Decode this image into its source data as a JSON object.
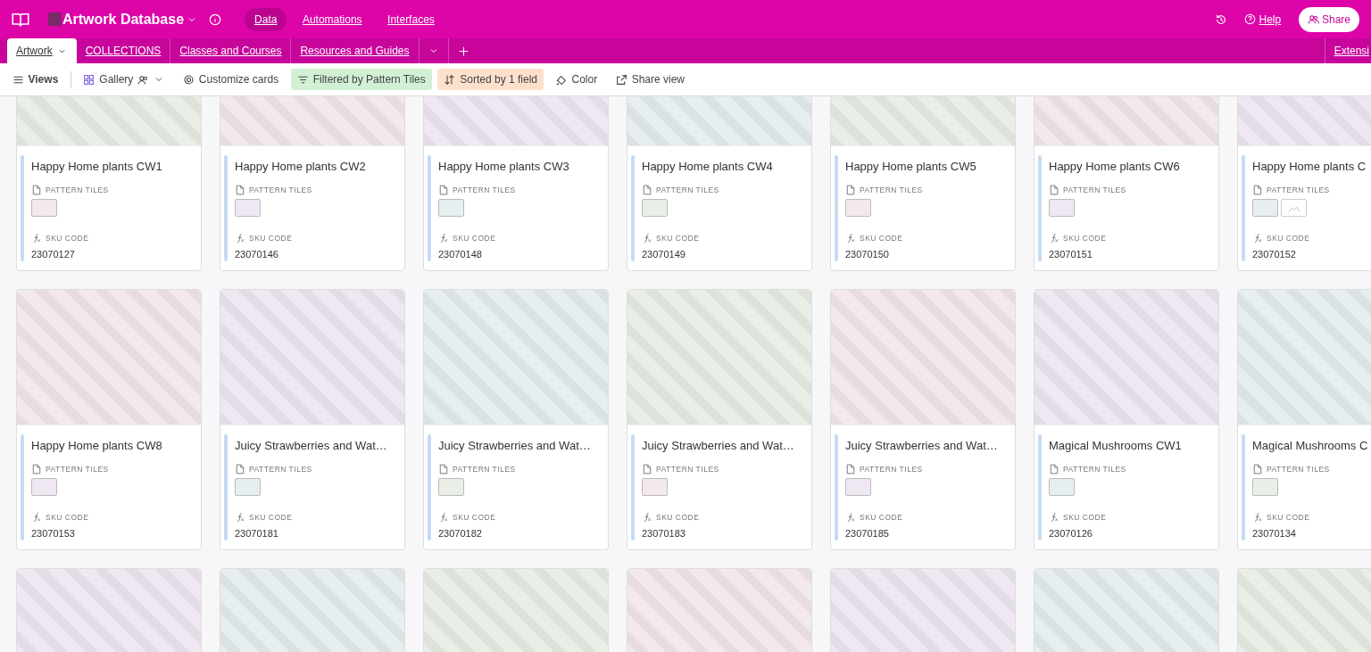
{
  "app": {
    "title": "Artwork Database",
    "nav": [
      {
        "label": "Data",
        "selected": true
      },
      {
        "label": "Automations",
        "selected": false
      },
      {
        "label": "Interfaces",
        "selected": false
      }
    ],
    "help": "Help",
    "share": "Share"
  },
  "tables": [
    {
      "label": "Artwork",
      "selected": true
    },
    {
      "label": "COLLECTIONS",
      "selected": false
    },
    {
      "label": "Classes and Courses",
      "selected": false
    },
    {
      "label": "Resources and Guides",
      "selected": false
    }
  ],
  "extensions": "Extensi",
  "toolbar": [
    {
      "kind": "views",
      "label": "Views"
    },
    {
      "kind": "gallery",
      "label": "Gallery"
    },
    {
      "kind": "customize",
      "label": "Customize cards"
    },
    {
      "kind": "filter",
      "label": "Filtered by Pattern Tiles"
    },
    {
      "kind": "sort",
      "label": "Sorted by 1 field"
    },
    {
      "kind": "color",
      "label": "Color"
    },
    {
      "kind": "share",
      "label": "Share view"
    }
  ],
  "rows": [
    {
      "cards": [
        {
          "kind": "full",
          "title": "Happy Home plants CW1",
          "attachments_label": "PATTERN TILES",
          "attachments": [
            {
              "kind": "image"
            }
          ],
          "sku_label": "SKU CODE",
          "sku": "23070127"
        },
        {
          "kind": "full",
          "title": "Happy Home plants CW2",
          "attachments_label": "PATTERN TILES",
          "attachments": [
            {
              "kind": "image"
            }
          ],
          "sku_label": "SKU CODE",
          "sku": "23070146"
        },
        {
          "kind": "full",
          "title": "Happy Home plants CW3",
          "attachments_label": "PATTERN TILES",
          "attachments": [
            {
              "kind": "image"
            }
          ],
          "sku_label": "SKU CODE",
          "sku": "23070148"
        },
        {
          "kind": "full",
          "title": "Happy Home plants CW4",
          "attachments_label": "PATTERN TILES",
          "attachments": [
            {
              "kind": "image"
            }
          ],
          "sku_label": "SKU CODE",
          "sku": "23070149"
        },
        {
          "kind": "full",
          "title": "Happy Home plants CW5",
          "attachments_label": "PATTERN TILES",
          "attachments": [
            {
              "kind": "image"
            }
          ],
          "sku_label": "SKU CODE",
          "sku": "23070150"
        },
        {
          "kind": "full",
          "title": "Happy Home plants CW6",
          "attachments_label": "PATTERN TILES",
          "attachments": [
            {
              "kind": "image"
            }
          ],
          "sku_label": "SKU CODE",
          "sku": "23070151"
        },
        {
          "kind": "full",
          "title": "Happy Home plants C",
          "attachments_label": "PATTERN TILES",
          "attachments": [
            {
              "kind": "image"
            },
            {
              "kind": "empty"
            }
          ],
          "sku_label": "SKU CODE",
          "sku": "23070152"
        }
      ]
    },
    {
      "cards": [
        {
          "kind": "full",
          "title": "Happy Home plants CW8",
          "attachments_label": "PATTERN TILES",
          "attachments": [
            {
              "kind": "image"
            }
          ],
          "sku_label": "SKU CODE",
          "sku": "23070153"
        },
        {
          "kind": "full",
          "title": "Juicy Strawberries and Wat…",
          "attachments_label": "PATTERN TILES",
          "attachments": [
            {
              "kind": "image"
            }
          ],
          "sku_label": "SKU CODE",
          "sku": "23070181"
        },
        {
          "kind": "full",
          "title": "Juicy Strawberries and Wat…",
          "attachments_label": "PATTERN TILES",
          "attachments": [
            {
              "kind": "image"
            }
          ],
          "sku_label": "SKU CODE",
          "sku": "23070182"
        },
        {
          "kind": "full",
          "title": "Juicy Strawberries and Wat…",
          "attachments_label": "PATTERN TILES",
          "attachments": [
            {
              "kind": "image"
            }
          ],
          "sku_label": "SKU CODE",
          "sku": "23070183"
        },
        {
          "kind": "full",
          "title": "Juicy Strawberries and Wat…",
          "attachments_label": "PATTERN TILES",
          "attachments": [
            {
              "kind": "image"
            }
          ],
          "sku_label": "SKU CODE",
          "sku": "23070185"
        },
        {
          "kind": "full",
          "title": "Magical Mushrooms CW1",
          "attachments_label": "PATTERN TILES",
          "attachments": [
            {
              "kind": "image"
            }
          ],
          "sku_label": "SKU CODE",
          "sku": "23070126"
        },
        {
          "kind": "full",
          "title": "Magical Mushrooms C",
          "attachments_label": "PATTERN TILES",
          "attachments": [
            {
              "kind": "image"
            }
          ],
          "sku_label": "SKU CODE",
          "sku": "23070134"
        }
      ]
    },
    {
      "cards": [
        {
          "kind": "cut"
        },
        {
          "kind": "cut"
        },
        {
          "kind": "cut"
        },
        {
          "kind": "cut"
        },
        {
          "kind": "cut"
        },
        {
          "kind": "cut"
        },
        {
          "kind": "cut"
        }
      ]
    }
  ]
}
